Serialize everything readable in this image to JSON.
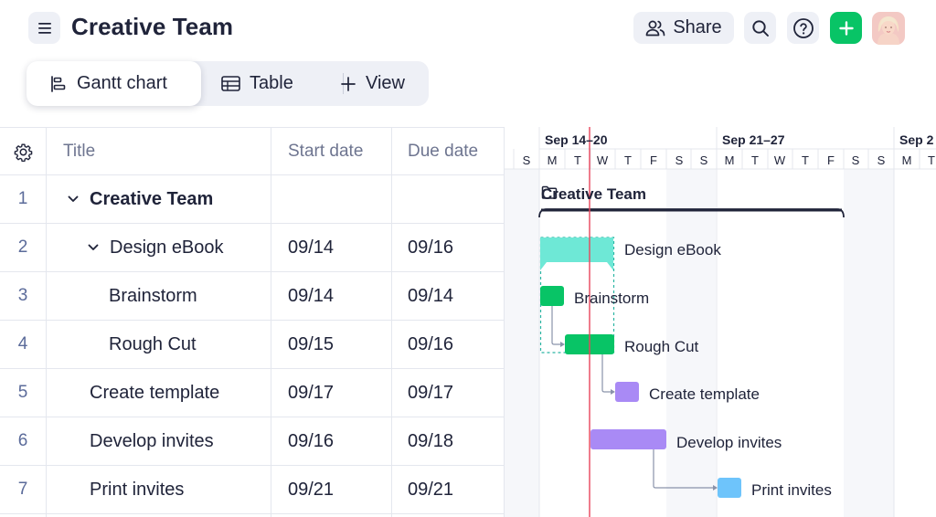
{
  "header": {
    "title": "Creative Team",
    "share_label": "Share"
  },
  "views": {
    "gantt_label": "Gantt chart",
    "table_label": "Table",
    "add_view_label": "View"
  },
  "columns": {
    "title": "Title",
    "start": "Start date",
    "due": "Due date"
  },
  "rows": [
    {
      "num": "1",
      "title": "Creative Team",
      "start": "",
      "due": ""
    },
    {
      "num": "2",
      "title": "Design eBook",
      "start": "09/14",
      "due": "09/16"
    },
    {
      "num": "3",
      "title": "Brainstorm",
      "start": "09/14",
      "due": "09/14"
    },
    {
      "num": "4",
      "title": "Rough Cut",
      "start": "09/15",
      "due": "09/16"
    },
    {
      "num": "5",
      "title": "Create template",
      "start": "09/17",
      "due": "09/17"
    },
    {
      "num": "6",
      "title": "Develop invites",
      "start": "09/16",
      "due": "09/18"
    },
    {
      "num": "7",
      "title": "Print invites",
      "start": "09/21",
      "due": "09/21"
    }
  ],
  "timeline": {
    "weeks": [
      "Sep 14–20",
      "Sep 21–27",
      "Sep 2"
    ],
    "days": [
      "S",
      "M",
      "T",
      "W",
      "T",
      "F",
      "S",
      "S",
      "M",
      "T",
      "W",
      "T",
      "F",
      "S",
      "S",
      "M",
      "T"
    ]
  },
  "gantt": {
    "group_label": "Creative Team",
    "bars": [
      {
        "label": "Design eBook",
        "color": "#6ee8d6"
      },
      {
        "label": "Brainstorm",
        "color": "#08c466"
      },
      {
        "label": "Rough Cut",
        "color": "#08c466"
      },
      {
        "label": "Create template",
        "color": "#a98af5"
      },
      {
        "label": "Develop invites",
        "color": "#a98af5"
      },
      {
        "label": "Print invites",
        "color": "#6ec4fb"
      }
    ],
    "today_color": "#e8455b"
  },
  "colors": {
    "accent_green": "#08c466",
    "button_bg": "#eef0f6"
  }
}
